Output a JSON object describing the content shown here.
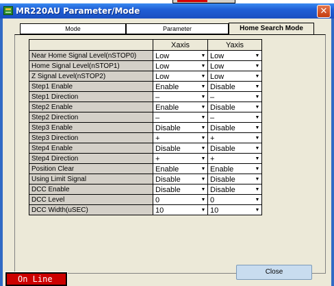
{
  "window": {
    "title": "MR220AU Parameter/Mode",
    "close_glyph": "✕"
  },
  "tabs": [
    {
      "label": "Mode",
      "active": false
    },
    {
      "label": "Parameter",
      "active": false
    },
    {
      "label": "Home Search Mode",
      "active": true
    }
  ],
  "table": {
    "columns": [
      "Xaxis",
      "Yaxis"
    ],
    "rows": [
      {
        "label": "Near Home Signal Level(nSTOP0)",
        "x": "Low",
        "y": "Low"
      },
      {
        "label": "Home Signal Level(nSTOP1)",
        "x": "Low",
        "y": "Low"
      },
      {
        "label": "Z Signal Level(nSTOP2)",
        "x": "Low",
        "y": "Low"
      },
      {
        "label": "Step1 Enable",
        "x": "Enable",
        "y": "Disable"
      },
      {
        "label": "Step1 Direction",
        "x": "–",
        "y": "–"
      },
      {
        "label": "Step2 Enable",
        "x": "Enable",
        "y": "Disable"
      },
      {
        "label": "Step2 Direction",
        "x": "–",
        "y": "–"
      },
      {
        "label": "Step3 Enable",
        "x": "Disable",
        "y": "Disable"
      },
      {
        "label": "Step3 Direction",
        "x": "+",
        "y": "+"
      },
      {
        "label": "Step4 Enable",
        "x": "Disable",
        "y": "Disable"
      },
      {
        "label": "Step4 Direction",
        "x": "+",
        "y": "+"
      },
      {
        "label": "Position Clear",
        "x": "Enable",
        "y": "Enable"
      },
      {
        "label": "Using Limit Signal",
        "x": "Disable",
        "y": "Disable"
      },
      {
        "label": "DCC Enable",
        "x": "Disable",
        "y": "Disable"
      },
      {
        "label": "DCC Level",
        "x": "0",
        "y": "0"
      },
      {
        "label": "DCC Width(uSEC)",
        "x": "10",
        "y": "10"
      }
    ]
  },
  "status": {
    "label": "On Line",
    "color": "#cc0000"
  },
  "buttons": {
    "close_label": "Close"
  },
  "icons": {
    "dropdown": "chevron-down-icon",
    "app": "app-icon"
  }
}
